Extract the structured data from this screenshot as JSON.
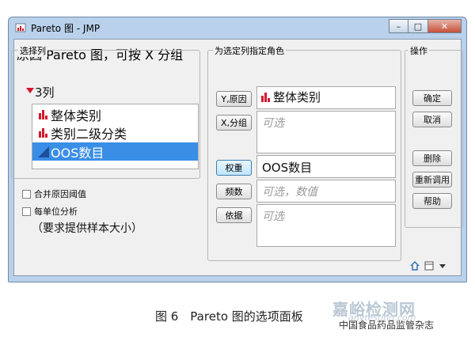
{
  "window": {
    "title": "Pareto 图 - JMP",
    "minimize": "–",
    "maximize": "□",
    "close": "✕"
  },
  "dialog": {
    "heading": "原因 Pareto 图，可按 X 分组"
  },
  "select_columns": {
    "legend": "选择列",
    "count_label": "3列",
    "columns": [
      {
        "label": "整体类别",
        "icon": "nominal-bar-icon",
        "selected": false
      },
      {
        "label": "类别二级分类",
        "icon": "nominal-bar-icon",
        "selected": false
      },
      {
        "label": "OOS数目",
        "icon": "continuous-triangle-icon",
        "selected": true
      }
    ],
    "checkboxes": [
      {
        "label": "合并原因阈值",
        "checked": false
      },
      {
        "label": "每单位分析",
        "checked": false
      }
    ],
    "hint": "（要求提供样本大小）"
  },
  "roles": {
    "legend": "为选定列指定角色",
    "items": [
      {
        "button": "Y,原因",
        "value": "整体类别",
        "placeholder": ""
      },
      {
        "button": "X,分组",
        "value": "",
        "placeholder": "可选"
      },
      {
        "button": "权重",
        "value": "OOS数目",
        "placeholder": ""
      },
      {
        "button": "频数",
        "value": "",
        "placeholder": "可选，数值"
      },
      {
        "button": "依据",
        "value": "",
        "placeholder": "可选"
      }
    ]
  },
  "actions": {
    "legend": "操作",
    "ok": "确定",
    "cancel": "取消",
    "remove": "删除",
    "recall": "重新调用",
    "help": "帮助"
  },
  "caption": "图 6　Pareto 图的选项面板",
  "watermark": {
    "main": "嘉峪检测网",
    "url": "anytesting.com",
    "source": "中国食品药品监管杂志"
  },
  "colors": {
    "selection": "#3a8ee6",
    "title_bar": "#b9d1ea",
    "close_button": "#c5503b",
    "red_icon": "#d2192b"
  }
}
